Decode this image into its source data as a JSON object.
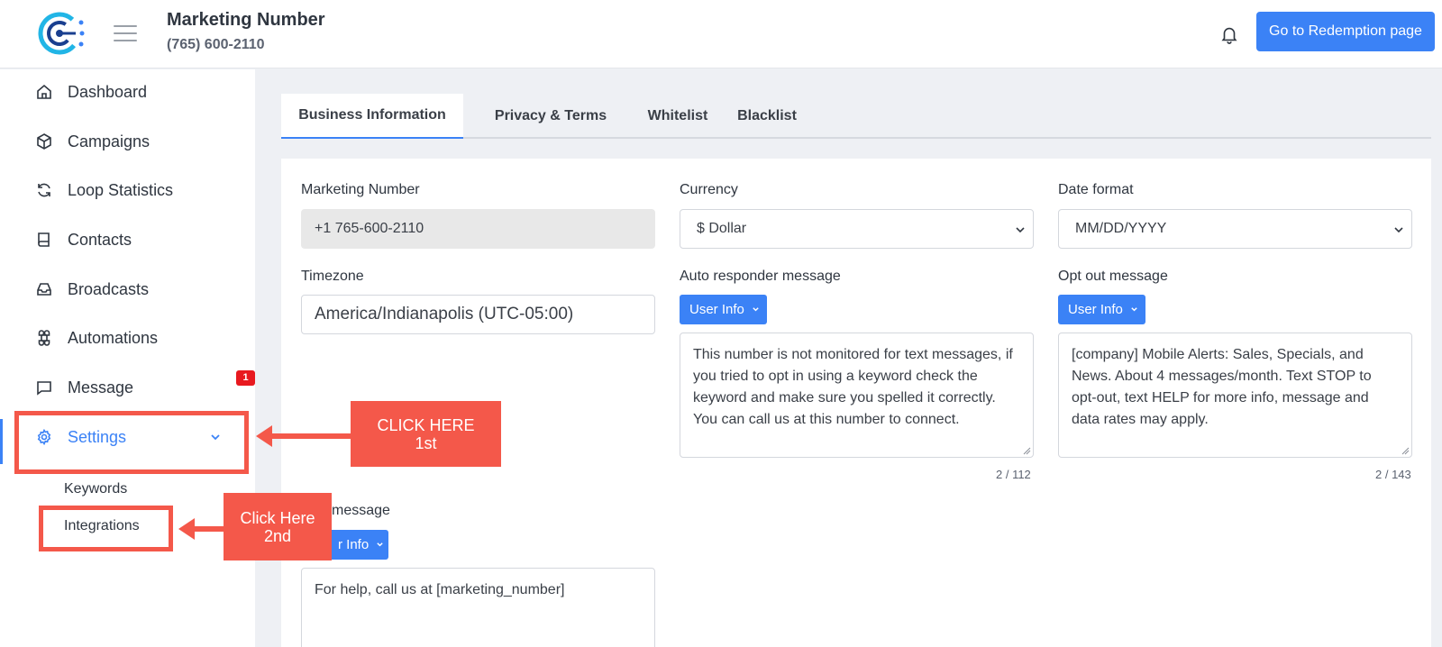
{
  "header": {
    "title": "Marketing Number",
    "subtitle": "(765) 600-2110",
    "redeem_label": "Go to Redemption page"
  },
  "sidebar": {
    "items": [
      {
        "label": "Dashboard",
        "icon": "home-icon"
      },
      {
        "label": "Campaigns",
        "icon": "box-icon"
      },
      {
        "label": "Loop Statistics",
        "icon": "refresh-icon"
      },
      {
        "label": "Contacts",
        "icon": "book-icon"
      },
      {
        "label": "Broadcasts",
        "icon": "inbox-icon"
      },
      {
        "label": "Automations",
        "icon": "command-icon"
      },
      {
        "label": "Message",
        "icon": "chat-icon"
      },
      {
        "label": "Settings",
        "icon": "gear-icon"
      }
    ],
    "message_badge": "1",
    "submenu": [
      "Keywords",
      "Integrations"
    ]
  },
  "annotations": {
    "first_line1": "CLICK HERE",
    "first_line2": "1st",
    "second_line1": "Click Here",
    "second_line2": "2nd",
    "color": "#f4584a"
  },
  "tabs": [
    "Business Information",
    "Privacy & Terms",
    "Whitelist",
    "Blacklist"
  ],
  "form": {
    "marketing_number": {
      "label": "Marketing Number",
      "value": "+1 765-600-2110"
    },
    "currency": {
      "label": "Currency",
      "value": "$ Dollar"
    },
    "date_format": {
      "label": "Date format",
      "value": "MM/DD/YYYY"
    },
    "timezone": {
      "label": "Timezone",
      "value": "America/Indianapolis (UTC-05:00)"
    },
    "auto_responder": {
      "label": "Auto responder message",
      "button": "User Info",
      "value": "This number is not monitored for text messages, if you tried to opt in using a keyword check the keyword and make sure you spelled it correctly. You can call us at this number to connect.",
      "counter": "2 / 112"
    },
    "opt_out": {
      "label": "Opt out message",
      "button": "User Info",
      "value": "[company] Mobile Alerts: Sales, Specials, and News. About 4 messages/month. Text STOP to opt-out, text HELP for more info, message and data rates may apply.",
      "counter": "2 / 143"
    },
    "help": {
      "label": "message",
      "button": "r Info",
      "value": "For help, call us at [marketing_number]"
    }
  },
  "colors": {
    "accent": "#3b82f6",
    "badge": "#e8191f"
  }
}
